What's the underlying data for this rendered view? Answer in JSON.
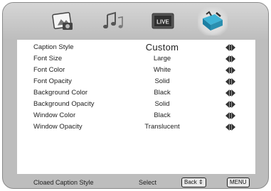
{
  "tabs": [
    {
      "name": "picture-icon"
    },
    {
      "name": "music-notes-icon"
    },
    {
      "name": "live-tv-icon",
      "label": "LIVE"
    },
    {
      "name": "toolbox-icon"
    }
  ],
  "menu": {
    "items": [
      {
        "label": "Caption Style",
        "value": "Custom"
      },
      {
        "label": "Font Size",
        "value": "Large"
      },
      {
        "label": "Font Color",
        "value": "White"
      },
      {
        "label": "Font Opacity",
        "value": "Solid"
      },
      {
        "label": "Background Color",
        "value": "Black"
      },
      {
        "label": "Background Opacity",
        "value": "Solid"
      },
      {
        "label": "Window Color",
        "value": "Black"
      },
      {
        "label": "Window Opacity",
        "value": "Translucent"
      }
    ]
  },
  "footer": {
    "title": "Cloaed Caption Style",
    "select_label": "Select",
    "back_key": "Back ⇕",
    "menu_key": "MENU"
  },
  "colors": {
    "frame": "#bdbdbd",
    "panel": "#ffffff",
    "accent": "#2a8fb0"
  }
}
